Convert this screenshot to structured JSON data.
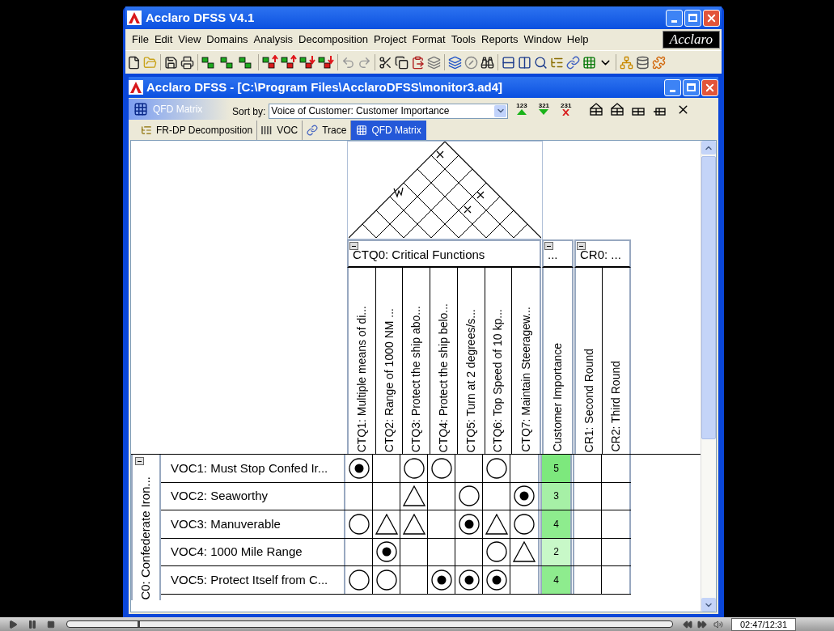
{
  "window": {
    "title": "Acclaro DFSS V4.1"
  },
  "menu": [
    "File",
    "Edit",
    "View",
    "Domains",
    "Analysis",
    "Decomposition",
    "Project",
    "Format",
    "Tools",
    "Reports",
    "Window",
    "Help"
  ],
  "logo": "Acclaro",
  "document": {
    "title": "Acclaro DFSS - [C:\\Program Files\\AcclaroDFSS\\monitor3.ad4]"
  },
  "view_label": "QFD Matrix",
  "sort": {
    "label": "Sort by:",
    "value": "Voice of Customer: Customer Importance",
    "buttons": [
      {
        "digits": "123",
        "kind": "up"
      },
      {
        "digits": "321",
        "kind": "down"
      },
      {
        "digits": "231",
        "kind": "clear"
      }
    ]
  },
  "tabs": [
    {
      "label": "FR-DP Decomposition",
      "kind": "tree",
      "selected": false
    },
    {
      "label": "VOC",
      "kind": "voc",
      "selected": false
    },
    {
      "label": "Trace",
      "kind": "trace",
      "selected": false
    },
    {
      "label": "QFD Matrix",
      "kind": "qfd",
      "selected": true
    }
  ],
  "column_groups": [
    {
      "label": "CTQ0: Critical Functions",
      "kind": "ctq",
      "columns": [
        "CTQ1: Multiple means of di...",
        "CTQ2: Range of 1000 NM ...",
        "CTQ3: Protect the ship abo...",
        "CTQ4: Protect the ship belo...",
        "CTQ5: Turn at 2 degrees/s...",
        "CTQ6: Top Speed of 10 kp...",
        "CTQ7: Maintain Steeragew..."
      ]
    },
    {
      "label": "...",
      "kind": "importance",
      "columns": [
        "Customer Importance"
      ]
    },
    {
      "label": "CR0: ...",
      "kind": "rating",
      "columns": [
        "CR1: Second Round",
        "CR2: Third Round"
      ]
    }
  ],
  "row_group": "C0: Confederate Iron...",
  "rows": [
    {
      "label": "VOC1: Must Stop Confed Ir...",
      "relations": [
        {
          "kind": "strong"
        },
        {
          "kind": "none"
        },
        {
          "kind": "medium"
        },
        {
          "kind": "medium"
        },
        {
          "kind": "none"
        },
        {
          "kind": "medium"
        },
        {
          "kind": "none"
        }
      ],
      "importance": {
        "text": "5",
        "color": "#7de87d"
      }
    },
    {
      "label": "VOC2: Seaworthy",
      "relations": [
        {
          "kind": "none"
        },
        {
          "kind": "none"
        },
        {
          "kind": "weak"
        },
        {
          "kind": "none"
        },
        {
          "kind": "medium"
        },
        {
          "kind": "none"
        },
        {
          "kind": "strong"
        }
      ],
      "importance": {
        "text": "3",
        "color": "#a6f0a6"
      }
    },
    {
      "label": "VOC3: Manuverable",
      "relations": [
        {
          "kind": "medium"
        },
        {
          "kind": "weak"
        },
        {
          "kind": "weak"
        },
        {
          "kind": "none"
        },
        {
          "kind": "strong"
        },
        {
          "kind": "weak"
        },
        {
          "kind": "medium"
        }
      ],
      "importance": {
        "text": "4",
        "color": "#8eec8e"
      }
    },
    {
      "label": "VOC4: 1000 Mile Range",
      "relations": [
        {
          "kind": "none"
        },
        {
          "kind": "strong"
        },
        {
          "kind": "none"
        },
        {
          "kind": "none"
        },
        {
          "kind": "none"
        },
        {
          "kind": "medium"
        },
        {
          "kind": "weak"
        }
      ],
      "importance": {
        "text": "2",
        "color": "#c8f8c8"
      }
    },
    {
      "label": "VOC5: Protect Itself from C...",
      "relations": [
        {
          "kind": "medium"
        },
        {
          "kind": "medium"
        },
        {
          "kind": "none"
        },
        {
          "kind": "strong"
        },
        {
          "kind": "strong"
        },
        {
          "kind": "strong"
        },
        {
          "kind": "none"
        }
      ],
      "importance": {
        "text": "4",
        "color": "#8eec8e"
      }
    }
  ],
  "player": {
    "time": "02:47/12:31",
    "level": 0.12
  }
}
